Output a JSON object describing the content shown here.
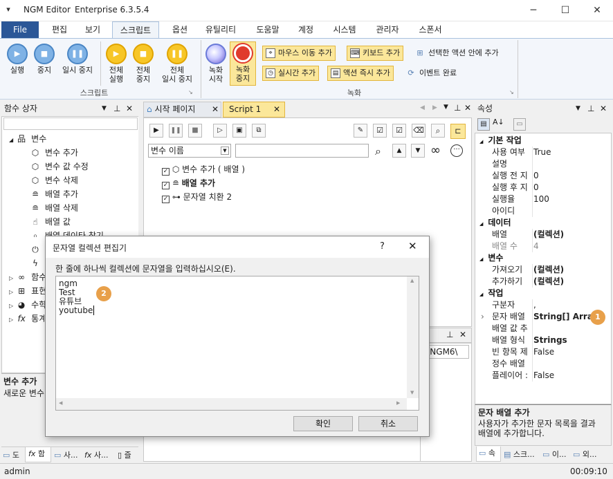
{
  "window": {
    "app_name": "NGM Editor",
    "edition": "Enterprise 6.3.5.4",
    "minimize_glyph": "─",
    "maximize_glyph": "☐",
    "close_glyph": "✕"
  },
  "menu": {
    "file": "File",
    "edit": "편집",
    "view": "보기",
    "script": "스크립트",
    "options": "옵션",
    "utility": "유틸리티",
    "help": "도움말",
    "account": "계정",
    "system": "시스템",
    "admin": "관리자",
    "sponsor": "스폰서"
  },
  "ribbon": {
    "script_group": "스크립트",
    "record_group": "녹화",
    "run": "실행",
    "stop": "중지",
    "pause": "일시 중지",
    "run_all_1": "전체",
    "run_all_2": "실행",
    "stop_all_1": "전체",
    "stop_all_2": "중지",
    "pause_all_1": "전체",
    "pause_all_2": "일시 중지",
    "record_start_1": "녹화",
    "record_start_2": "시작",
    "record_stop_1": "녹화",
    "record_stop_2": "중지",
    "add_mouse_move": "마우스 이동 추가",
    "add_keyboard": "키보드 추가",
    "add_in_selected": "선택한 액션 안에 추가",
    "add_realtime": "실시간 추가",
    "add_action_now": "액션 즉시 추가",
    "event_done": "이벤트 완료"
  },
  "left_panel": {
    "title": "함수 상자",
    "search_value": "",
    "root_variable": "변수",
    "items": [
      "변수 추가",
      "변수 값 수정",
      "변수 삭제",
      "배열 추가",
      "배열 삭제",
      "배열 값",
      "배열 데이타 찾기"
    ],
    "collapsed": [
      "함수",
      "표현",
      "수학",
      "통계"
    ],
    "desc_title": "변수 추가",
    "desc_text": "새로운 변수",
    "tabs": [
      "도",
      "함",
      "사...",
      "사...",
      "즐"
    ]
  },
  "editor": {
    "tab_start": "시작 페이지",
    "tab_script": "Script 1",
    "filter_select": "변수 이름",
    "filter_input": "",
    "rows": [
      {
        "label": "변수 추가 ( 배열 )",
        "bold": false
      },
      {
        "label": "배열 추가",
        "bold": true
      },
      {
        "label": "문자열 치환 2",
        "bold": false
      }
    ],
    "output_path": "s\\NGM6\\"
  },
  "properties": {
    "title": "속성",
    "sections": [
      {
        "name": "기본 작업",
        "rows": [
          {
            "k": "사용 여부",
            "v": "True"
          },
          {
            "k": "설명",
            "v": ""
          },
          {
            "k": "실행 전 지",
            "v": "0"
          },
          {
            "k": "실행 후 지",
            "v": "0"
          },
          {
            "k": "실행율",
            "v": "100"
          },
          {
            "k": "아이디",
            "v": ""
          }
        ]
      },
      {
        "name": "데이터",
        "rows": [
          {
            "k": "배열",
            "v": "(컬렉션)",
            "bold": true
          },
          {
            "k": "배열 수",
            "v": "4",
            "dim": true
          }
        ]
      },
      {
        "name": "변수",
        "rows": [
          {
            "k": "가져오기",
            "v": "(컬렉션)",
            "bold": true
          },
          {
            "k": "추가하기",
            "v": "(컬렉션)",
            "bold": true
          }
        ]
      },
      {
        "name": "작업",
        "rows": [
          {
            "k": "구분자",
            "v": ","
          },
          {
            "k": "문자 배열",
            "v": "String[] Array",
            "bold": true,
            "expand": true
          },
          {
            "k": "배열 값 추",
            "v": ""
          },
          {
            "k": "배열 형식",
            "v": "Strings",
            "bold": true
          },
          {
            "k": "빈 항목 제",
            "v": "False"
          },
          {
            "k": "정수 배열",
            "v": ""
          },
          {
            "k": "플레이어 :",
            "v": "False"
          }
        ]
      }
    ],
    "desc_title": "문자 배열 추가",
    "desc_text_1": "사용자가 추가한 문자 목록을 결과",
    "desc_text_2": "배열에 추가합니다.",
    "tabs": [
      "속",
      "스크...",
      "이...",
      "외..."
    ],
    "badge_1": "1"
  },
  "dialog": {
    "title": "문자열 컬렉션 편집기",
    "help_glyph": "?",
    "instruction": "한 줄에 하나씩 컬렉션에 문자열을 입력하십시오(E).",
    "lines": [
      "ngm",
      "Test",
      "유튜브",
      "youtube"
    ],
    "ok": "확인",
    "cancel": "취소",
    "badge_2": "2"
  },
  "status": {
    "user": "admin",
    "time": "00:09:10"
  }
}
